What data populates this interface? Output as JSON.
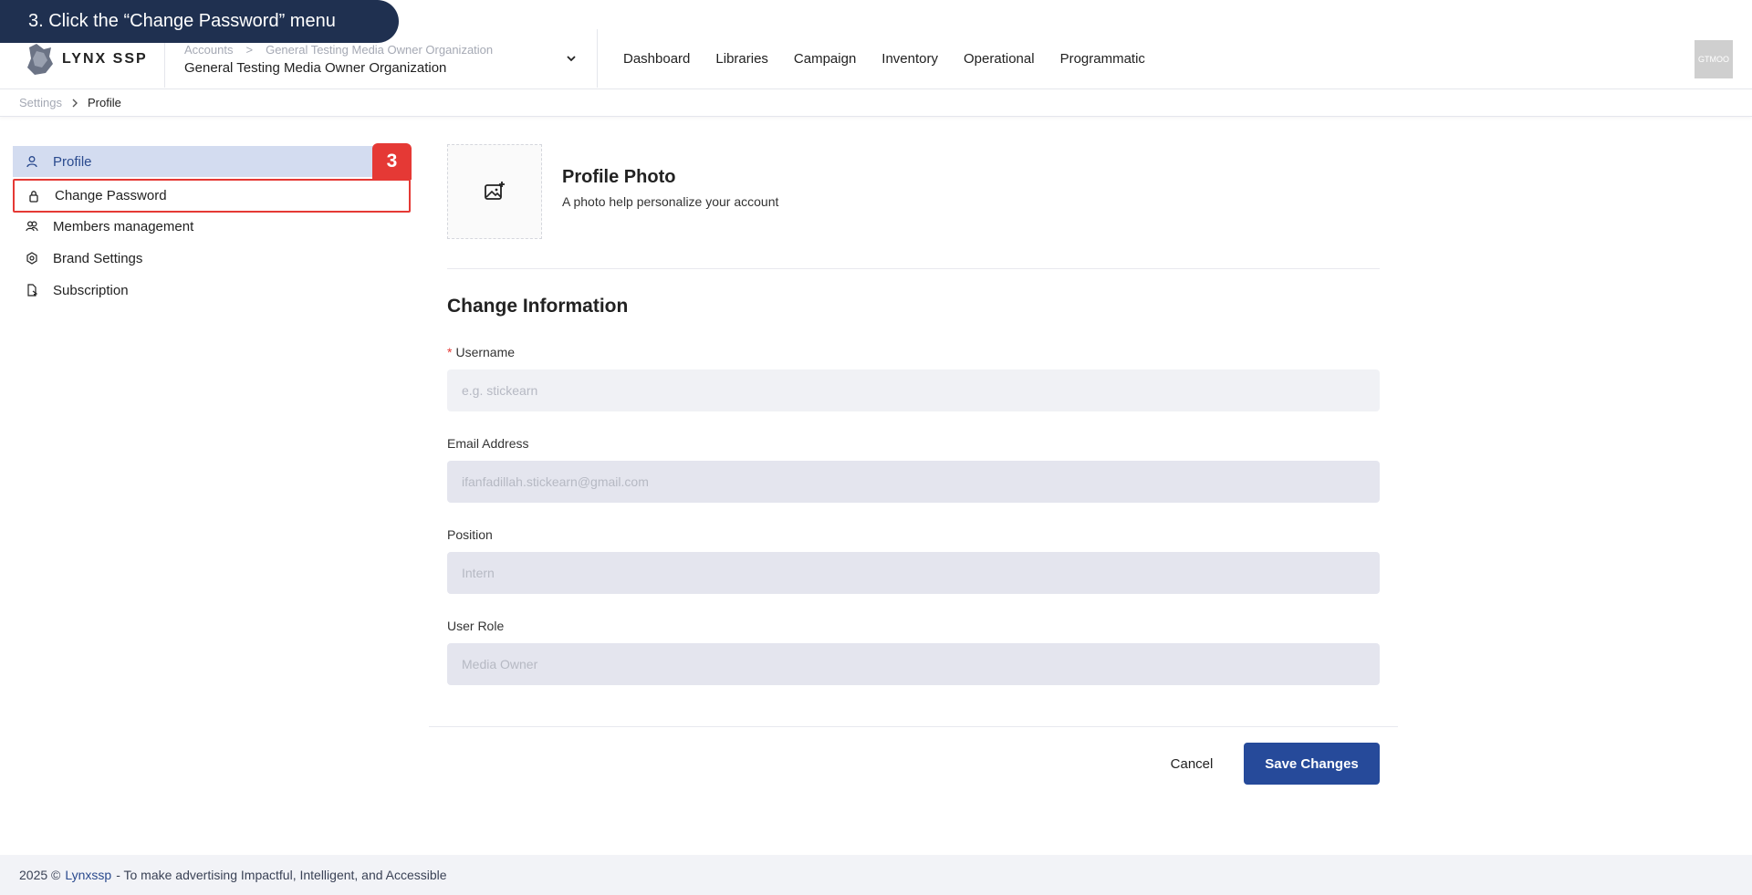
{
  "tutorial": {
    "step_label": "3. Click the “Change Password” menu",
    "badge": "3"
  },
  "header": {
    "logo_text": "LYNX SSP",
    "account": {
      "crumb_1": "Accounts",
      "crumb_sep": ">",
      "crumb_2": "General Testing Media Owner Organization",
      "name": "General Testing Media Owner Organization"
    },
    "nav": [
      "Dashboard",
      "Libraries",
      "Campaign",
      "Inventory",
      "Operational",
      "Programmatic"
    ],
    "avatar_text": "GTMOO"
  },
  "breadcrumb": {
    "parent": "Settings",
    "sep": ">",
    "current": "Profile"
  },
  "sidebar": {
    "items": [
      {
        "label": "Profile",
        "icon": "user-icon"
      },
      {
        "label": "Change Password",
        "icon": "lock-icon"
      },
      {
        "label": "Members management",
        "icon": "users-icon"
      },
      {
        "label": "Brand Settings",
        "icon": "gear-icon"
      },
      {
        "label": "Subscription",
        "icon": "document-icon"
      }
    ]
  },
  "profile_photo": {
    "title": "Profile Photo",
    "subtitle": "A photo help personalize your account"
  },
  "form": {
    "title": "Change Information",
    "username": {
      "required_mark": "*",
      "label": "Username",
      "placeholder": "e.g. stickearn"
    },
    "email": {
      "label": "Email Address",
      "value": "ifanfadillah.stickearn@gmail.com"
    },
    "position": {
      "label": "Position",
      "value": "Intern"
    },
    "role": {
      "label": "User Role",
      "value": "Media Owner"
    }
  },
  "actions": {
    "cancel": "Cancel",
    "save": "Save Changes"
  },
  "footer": {
    "year": "2025 ©",
    "brand": "Lynxssp",
    "tagline": "- To make advertising Impactful, Intelligent, and Accessible"
  },
  "colors": {
    "primary": "#264a9a",
    "banner": "#1f3050",
    "highlight": "#e53935",
    "active_bg": "#d3dcf0"
  }
}
